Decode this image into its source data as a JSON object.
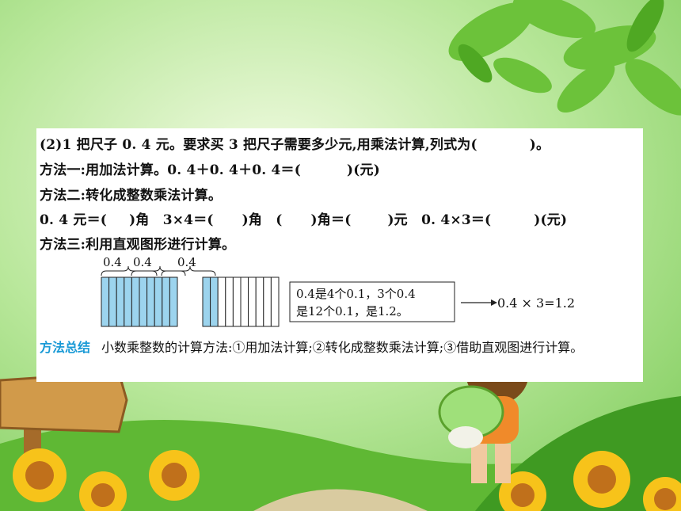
{
  "question": {
    "line1": "(2)1 把尺子 0. 4 元。要求买 3 把尺子需要多少元,用乘法计算,列式为(",
    "line1_end": ")。",
    "line2_a": "方法一:用加法计算。0. 4＋0. 4＋0. 4＝(",
    "line2_b": ")(元)",
    "line3": "方法二:转化成整数乘法计算。",
    "line4_a": "0. 4 元＝(",
    "line4_b": ")角　3×4＝(",
    "line4_c": ")角　(",
    "line4_d": ")角＝(",
    "line4_e": ")元　0. 4×3＝(",
    "line4_f": ")(元)",
    "line5": "方法三:利用直观图形进行计算。"
  },
  "figure": {
    "bracket_labels": [
      "0.4",
      "0.4",
      "0.4"
    ],
    "box_line1": "0.4是4个0.1，3个0.4",
    "box_line2": "是12个0.1，是1.2。",
    "result": "0.4 × 3=1.2",
    "shaded_strips": 12,
    "total_strips": 10
  },
  "summary": {
    "title": "方法总结",
    "text": "小数乘整数的计算方法:①用加法计算;②转化成整数乘法计算;③借助直观图进行计算。"
  },
  "colors": {
    "sky": "#9fdc7c",
    "grass": "#4cae2b",
    "summary_title": "#1a9ad6",
    "strip_fill": "#9cd4ee"
  }
}
